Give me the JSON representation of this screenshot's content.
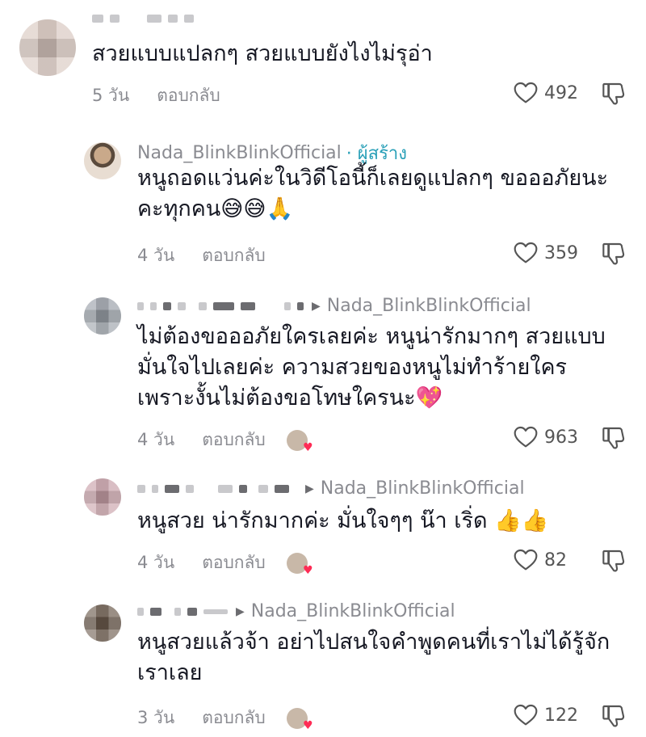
{
  "comments": [
    {
      "text_lines": [
        "สวยแบบแปลกๆ สวยแบบยังไงไม่รุอ่า"
      ],
      "time": "5 วัน",
      "reply": "ตอบกลับ",
      "likes": "492"
    },
    {
      "username": "Nada_BlinkBlinkOfficial",
      "creator_badge": "· ผู้สร้าง",
      "text_lines": [
        "หนูถอดแว่นค่ะในวิดีโอนี้ก็เลยดูแปลกๆ ขอออภัยนะ",
        "คะทุกคน😅😅🙏"
      ],
      "time": "4 วัน",
      "reply": "ตอบกลับ",
      "likes": "359"
    },
    {
      "reply_to": "Nada_BlinkBlinkOfficial",
      "text_lines": [
        "ไม่ต้องขอออภัยใครเลยค่ะ หนูน่ารักมากๆ สวยแบบ",
        "มั่นใจไปเลยค่ะ ความสวยของหนูไม่ทำร้ายใคร",
        "เพราะงั้นไม่ต้องขอโทษใครนะ💖"
      ],
      "time": "4 วัน",
      "reply": "ตอบกลับ",
      "likes": "963"
    },
    {
      "reply_to": "Nada_BlinkBlinkOfficial",
      "text_lines": [
        "หนูสวย น่ารักมากค่ะ มั่นใจๆๆ น๊า เริ่ด 👍👍"
      ],
      "time": "4 วัน",
      "reply": "ตอบกลับ",
      "likes": "82"
    },
    {
      "reply_to": "Nada_BlinkBlinkOfficial",
      "text_lines": [
        "หนูสวยแล้วจ้า อย่าไปสนใจคำพูดคนที่เราไม่ได้รู้จัก",
        "เราเลย"
      ],
      "time": "3 วัน",
      "reply": "ตอบกลับ",
      "likes": "122"
    }
  ],
  "icons": {
    "like": "heart-outline-icon",
    "dislike": "thumbs-down-outline-icon",
    "reply_arrow": "triangle-right-icon",
    "creator_liked": "creator-avatar-heart-icon"
  },
  "colors": {
    "text": "#161823",
    "muted": "#8a8b91",
    "creator_accent": "#2aa0b8",
    "heart": "#fe2c55"
  }
}
